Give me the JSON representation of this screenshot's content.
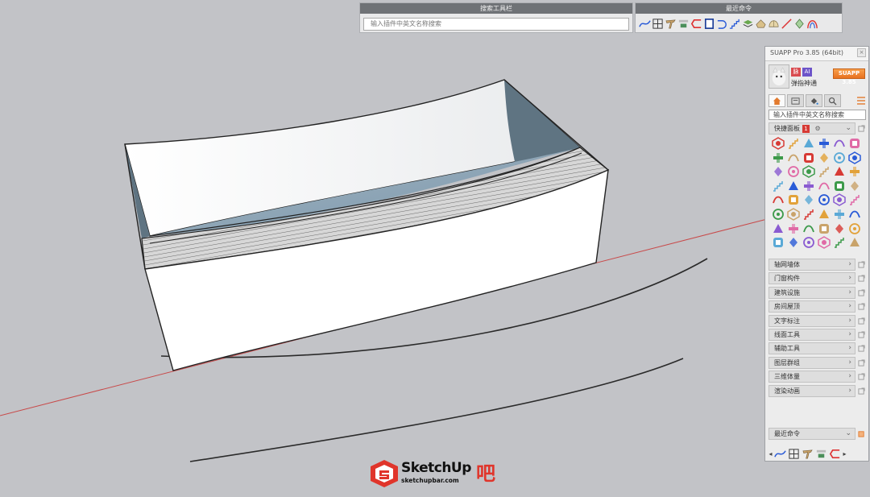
{
  "search_toolbar": {
    "title": "搜索工具栏",
    "placeholder": "输入插件中英文名称搜索"
  },
  "recent_toolbar": {
    "title": "最近命令",
    "icons": [
      "curve-icon",
      "grid-icon",
      "beam-icon",
      "rebar-label-icon",
      "wall-corner-icon",
      "door-frame-icon",
      "pipe-bend-icon",
      "stairs-icon",
      "layer-stack-icon",
      "roof-icon",
      "dome-icon",
      "line-tool-icon",
      "mesh-icon",
      "arc-icon"
    ]
  },
  "panel": {
    "title": "SUAPP Pro 3.85 (64bit)",
    "close": "×",
    "vip_badge": "脉",
    "ai_badge": "AI",
    "user_name": "弹指神通",
    "version_button": "SUAPP 3.85",
    "search_value": "输入插件中英文名称搜索",
    "quick_panel": {
      "label": "快捷面板",
      "count": "1"
    },
    "categories": [
      {
        "label": "轴网墙体"
      },
      {
        "label": "门窗构件"
      },
      {
        "label": "建筑设施"
      },
      {
        "label": "房间屋顶"
      },
      {
        "label": "文字标注"
      },
      {
        "label": "线面工具"
      },
      {
        "label": "辅助工具"
      },
      {
        "label": "图层群组"
      },
      {
        "label": "三维体量"
      },
      {
        "label": "渲染动画"
      }
    ],
    "recent": {
      "label": "最近命令"
    },
    "chevron_right": "›",
    "chevron_down": "⌄",
    "nav_left": "◂",
    "nav_right": "▸"
  },
  "logo": {
    "name": "SketchUp",
    "suffix": "吧",
    "url": "sketchupbar.com"
  },
  "colors": {
    "background": "#c2c3c7",
    "red_axis": "#c84a4a",
    "accent_orange": "#f0883a",
    "inner_face": "#8ea6b7",
    "dark_face": "#5f7482"
  }
}
